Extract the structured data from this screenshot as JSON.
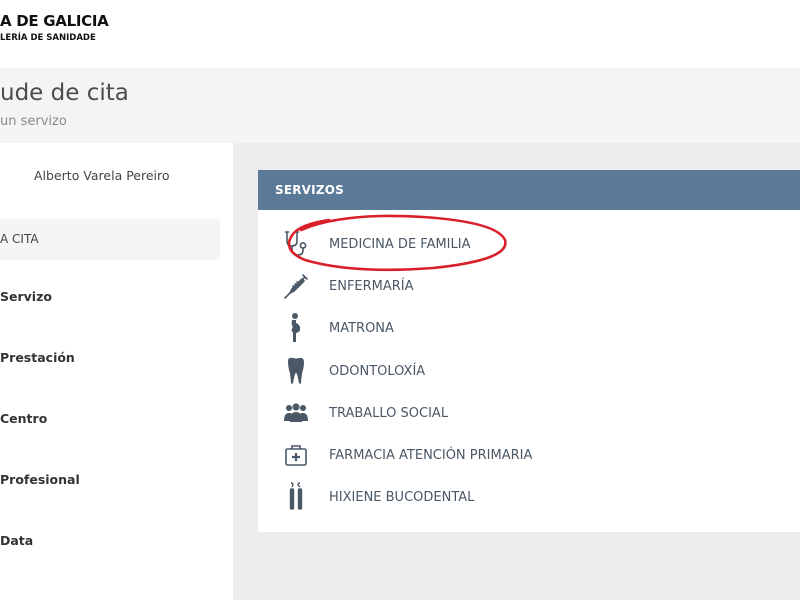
{
  "header": {
    "org_line1": "A DE GALICIA",
    "org_line2": "LERÍA DE SANIDADE"
  },
  "title": {
    "main": "ude de cita",
    "sub": "un servizo"
  },
  "sidebar": {
    "user_name": "Alberto Varela Pereiro",
    "active_step": "A CITA",
    "steps": [
      {
        "label": "Servizo"
      },
      {
        "label": "Prestación"
      },
      {
        "label": "Centro"
      },
      {
        "label": "Profesional"
      },
      {
        "label": "Data"
      }
    ]
  },
  "services_panel": {
    "title": "SERVIZOS",
    "items": [
      {
        "label": "MEDICINA DE FAMILIA",
        "icon": "stethoscope-icon"
      },
      {
        "label": "ENFERMARÍA",
        "icon": "syringe-icon"
      },
      {
        "label": "MATRONA",
        "icon": "pregnant-woman-icon"
      },
      {
        "label": "ODONTOLOXÍA",
        "icon": "tooth-icon"
      },
      {
        "label": "TRABALLO SOCIAL",
        "icon": "people-group-icon"
      },
      {
        "label": "FARMACIA ATENCIÓN PRIMARIA",
        "icon": "medical-kit-icon"
      },
      {
        "label": "HIXIENE BUCODENTAL",
        "icon": "dental-tools-icon"
      }
    ]
  },
  "colors": {
    "panel_header": "#5b7a97",
    "highlight": "#d9202a",
    "icon": "#4a5866"
  }
}
